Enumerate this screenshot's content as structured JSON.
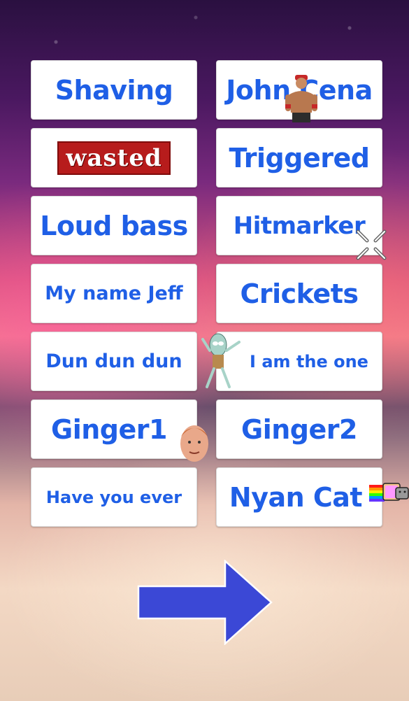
{
  "buttons": [
    {
      "label": "Shaving"
    },
    {
      "label": "John Cena"
    },
    {
      "label": "wasted"
    },
    {
      "label": "Triggered"
    },
    {
      "label": "Loud bass"
    },
    {
      "label": "Hitmarker"
    },
    {
      "label": "My name Jeff"
    },
    {
      "label": "Crickets"
    },
    {
      "label": "Dun dun dun"
    },
    {
      "label": "I am the one"
    },
    {
      "label": "Ginger1"
    },
    {
      "label": "Ginger2"
    },
    {
      "label": "Have you ever"
    },
    {
      "label": "Nyan Cat"
    }
  ],
  "colors": {
    "label_blue": "#1f5fe6",
    "arrow_blue": "#3b48d6",
    "wasted_red": "#b71c1c"
  },
  "icons": {
    "next": "right-arrow-icon"
  }
}
